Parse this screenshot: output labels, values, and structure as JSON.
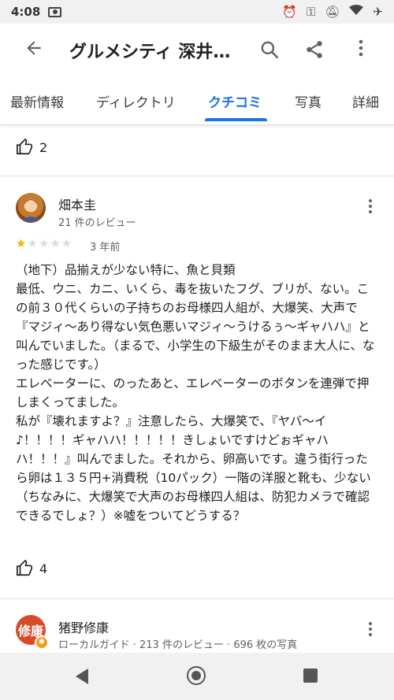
{
  "status": {
    "time": "4:08",
    "icons": [
      "alarm-icon",
      "key-icon",
      "mute-icon",
      "wifi-icon",
      "airplane-icon"
    ]
  },
  "appbar": {
    "title": "グルメシティ 深井駅店"
  },
  "tabs": [
    {
      "label": "最新情報",
      "active": false
    },
    {
      "label": "ディレクトリ",
      "active": false
    },
    {
      "label": "クチコミ",
      "active": true
    },
    {
      "label": "写真",
      "active": false
    },
    {
      "label": "詳細",
      "active": false
    }
  ],
  "prev_review": {
    "likes": "2"
  },
  "review1": {
    "name": "畑本圭",
    "meta": "21 件のレビュー",
    "rating": 1,
    "max_rating": 5,
    "date": "3 年前",
    "text": "（地下）品揃えが少ない特に、魚と貝類\n最低、ウニ、カニ、いくら、毒を抜いたフグ、ブリが、ない。この前３０代くらいの子持ちのお母様四人組が、大爆笑、大声で『マジィ〜あり得ない気色悪いマジィ〜うけるぅ〜ギャハハ』と叫んでいました。（まるで、小学生の下級生がそのまま大人に、なった感じです。）\nエレベーターに、のったあと、エレベーターのボタンを連弾で押しまくってました。\n私が『壊れますよ？』注意したら、大爆笑で、『ヤバ〜イ♪！！！！ギャハハ！！！！！きしょいですけどぉギャハハ！！！』叫んでました。それから、卵高いです。違う街行ったら卵は１３５円+消費税（10パック）一階の洋服と靴も、少ない（ちなみに、大爆笑で大声のお母様四人組は、防犯カメラで確認できるでしょ？）※嘘をついてどうする？",
    "likes": "4"
  },
  "review2": {
    "name": "猪野修康",
    "avatar_text": "修康",
    "meta": "ローカルガイド · 213 件のレビュー · 696 枚の写真"
  }
}
